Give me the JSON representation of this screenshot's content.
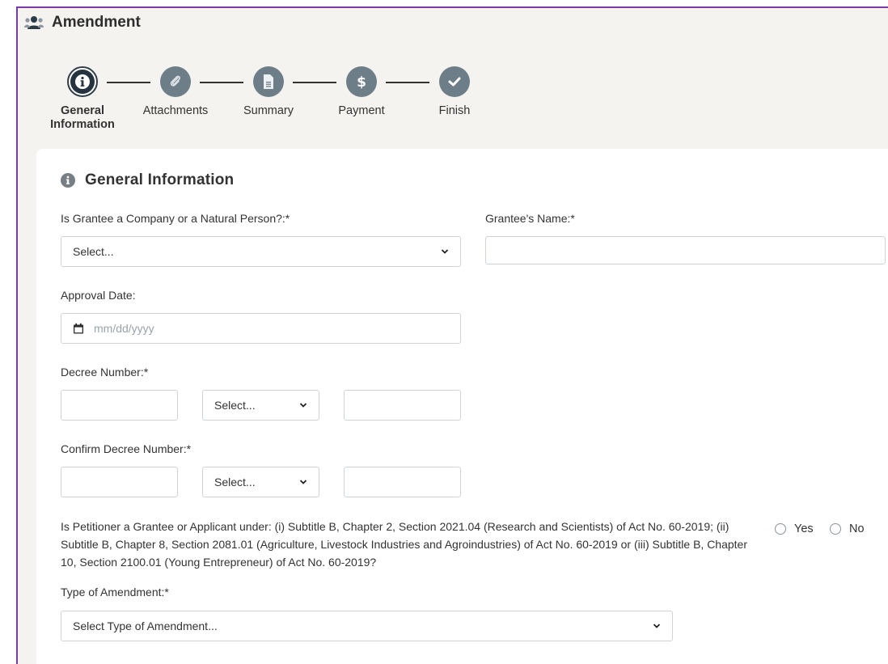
{
  "header": {
    "title": "Amendment",
    "icon": "users-icon"
  },
  "wizard": {
    "steps": [
      {
        "label": "General Information",
        "icon": "info-icon",
        "active": true
      },
      {
        "label": "Attachments",
        "icon": "paperclip-icon",
        "active": false
      },
      {
        "label": "Summary",
        "icon": "document-icon",
        "active": false
      },
      {
        "label": "Payment",
        "icon": "dollar-icon",
        "active": false
      },
      {
        "label": "Finish",
        "icon": "check-icon",
        "active": false
      }
    ]
  },
  "form": {
    "section_title": "General Information",
    "grantee_type": {
      "label": "Is Grantee a Company or a Natural Person?:*",
      "value": "Select..."
    },
    "grantee_name": {
      "label": "Grantee's Name:*",
      "value": ""
    },
    "approval_date": {
      "label": "Approval Date:",
      "placeholder": "mm/dd/yyyy"
    },
    "decree_number": {
      "label": "Decree Number:*",
      "select_value": "Select..."
    },
    "confirm_decree_number": {
      "label": "Confirm Decree Number:*",
      "select_value": "Select..."
    },
    "petitioner_question": {
      "text": "Is Petitioner a Grantee or Applicant under: (i) Subtitle B, Chapter 2, Section 2021.04 (Research and Scientists) of Act No. 60-2019; (ii) Subtitle B, Chapter 8, Section 2081.01 (Agriculture, Livestock Industries and Agroindustries) of Act No. 60-2019 or (iii) Subtitle B, Chapter 10, Section 2100.01 (Young Entrepreneur) of Act No. 60-2019?",
      "yes_label": "Yes",
      "no_label": "No"
    },
    "amendment_type": {
      "label": "Type of Amendment:*",
      "value": "Select Type of Amendment..."
    }
  },
  "colors": {
    "frame_border": "#7a3aa6",
    "step_active": "#263441",
    "step_inactive": "#6e7e89",
    "background": "#f4f3ef"
  }
}
